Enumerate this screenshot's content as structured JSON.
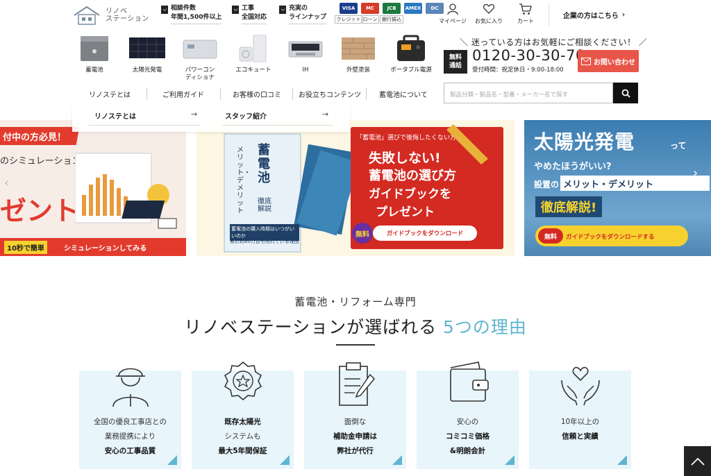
{
  "header": {
    "logo": {
      "line1": "リノベ",
      "line2": "ステーション"
    },
    "badges": [
      {
        "line1": "相談件数",
        "line2": "年間1,500件以上"
      },
      {
        "line1": "工事",
        "line2": "全国対応"
      },
      {
        "line1": "充実の",
        "line2": "ラインナップ"
      }
    ],
    "payments": [
      {
        "card": "VISA",
        "label": "クレジット",
        "color": "#1a3e8c"
      },
      {
        "card": "MC",
        "label": "ローン",
        "color": "#d63b2a"
      },
      {
        "card": "JCB",
        "label": "銀行振込",
        "color": "#1b7a3e"
      },
      {
        "card": "AMEX",
        "label": "",
        "color": "#2d78c1"
      },
      {
        "card": "DC",
        "label": "",
        "color": "#5a86b9"
      }
    ],
    "links": {
      "mypage": "マイページ",
      "favorite": "お気に入り",
      "cart": "カート"
    },
    "corporate": "企業の方はこちら"
  },
  "products": [
    {
      "label": "蓄電池"
    },
    {
      "label": "太陽光発電"
    },
    {
      "label": "パワーコン\nディショナ"
    },
    {
      "label": "エコキュート"
    },
    {
      "label": "IH"
    },
    {
      "label": "外壁塗装"
    },
    {
      "label": "ポータブル電源"
    }
  ],
  "contact": {
    "consult": "＼ 迷っている方はお気軽にご相談ください！ ／",
    "freecall1": "無料",
    "freecall2": "通話",
    "phone": "0120-30-30-70",
    "hours": "受付時間：祝定休日・9:00-18:00",
    "inquiry": "お問い合わせ"
  },
  "nav": {
    "items": [
      "リノステとは",
      "ご利用ガイド",
      "お客様の口コミ",
      "お役立ちコンテンツ",
      "蓄電池について"
    ],
    "search_placeholder": "製品分類・製品名・型番・メーカー名で探す"
  },
  "dropdown": {
    "items": [
      "リノステとは",
      "スタッフ紹介"
    ],
    "arrow": "→"
  },
  "banners": {
    "b1": {
      "top": "付中の方必見！",
      "mid": "のシミュレーション",
      "big": "ゼント",
      "cta1": "10秒で簡単",
      "cta2": "シミュレーションしてみる"
    },
    "b2": {
      "book_title": "蓄電池",
      "book_sub": "メリット・デメリット",
      "book_sub2": "徹底解説",
      "book_note": "蓄電池の購入時期はいつがいいのか",
      "book_note2": "累計約80万台も売れている理由",
      "ribbon": "「蓄電池」選びで後悔したくない方へ",
      "h1": "失敗しない!",
      "h2": "蓄電池の選び方",
      "h3": "ガイドブックを",
      "h4": "プレゼント",
      "free": "無料",
      "cta": "ガイドブックをダウンロード"
    },
    "b3": {
      "h1": "太陽光発電",
      "h1b": "って",
      "h2": "やめたほうがいい?",
      "h3a": "設置の",
      "h3b": "メリット・デメリット",
      "h4": "徹底解説!",
      "free": "無料",
      "cta": "ガイドブックをダウンロードする"
    }
  },
  "section": {
    "subtitle": "蓄電池・リフォーム専門",
    "title_main": "リノベステーションが選ばれる",
    "title_hl": "5つの理由",
    "reasons": [
      {
        "icon": "worker-icon",
        "l1": "全国の優良工事店との",
        "l2": "業務提携により",
        "l3": "安心の工事品質"
      },
      {
        "icon": "award-icon",
        "l1": "既存太陽光",
        "l2": "システムも",
        "l3": "最大5年間保証"
      },
      {
        "icon": "clipboard-icon",
        "l1": "面倒な",
        "l2": "補助金申請は",
        "l3": "弊社が代行"
      },
      {
        "icon": "wallet-icon",
        "l1": "安心の",
        "l2": "コミコミ価格",
        "l3": "&明朗会計"
      },
      {
        "icon": "heart-hands-icon",
        "l1": "10年以上の",
        "l2": "信頼と実績",
        "l3": ""
      }
    ]
  }
}
